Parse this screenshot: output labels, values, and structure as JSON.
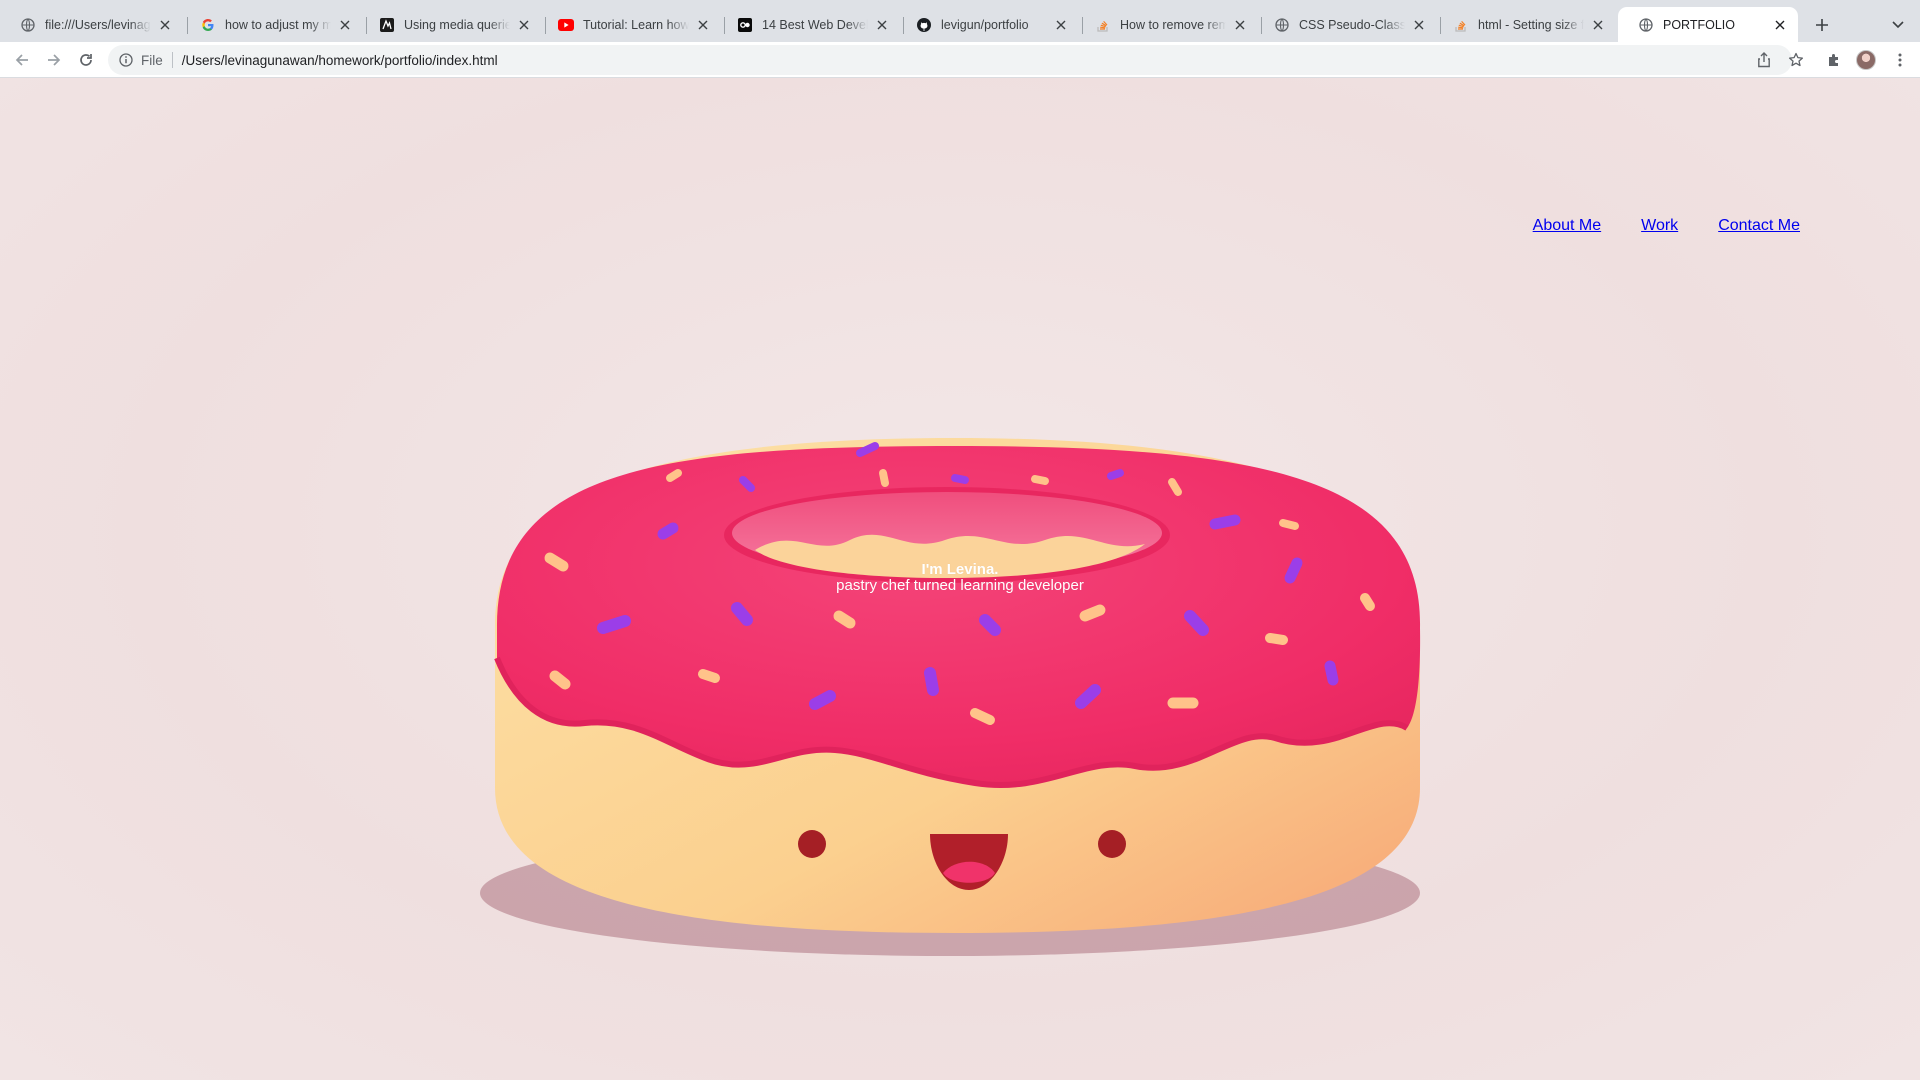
{
  "browser": {
    "tabs": [
      {
        "title": "file:///Users/levinagunawan",
        "icon": "globe-icon",
        "active": false
      },
      {
        "title": "how to adjust my media",
        "icon": "google-icon",
        "active": false
      },
      {
        "title": "Using media queries",
        "icon": "mdn-icon",
        "active": false
      },
      {
        "title": "Tutorial: Learn how to",
        "icon": "youtube-icon",
        "active": false
      },
      {
        "title": "14 Best Web Developer",
        "icon": "dev-icon",
        "active": false
      },
      {
        "title": "levigun/portfolio",
        "icon": "github-icon",
        "active": false
      },
      {
        "title": "How to remove remove",
        "icon": "stackoverflow-icon",
        "active": false
      },
      {
        "title": "CSS Pseudo-Classes",
        "icon": "globe-icon",
        "active": false
      },
      {
        "title": "html - Setting size for",
        "icon": "stackoverflow-icon",
        "active": false
      },
      {
        "title": "PORTFOLIO",
        "icon": "globe-icon",
        "active": true
      }
    ],
    "address": {
      "scheme_label": "File",
      "url": "/Users/levinagunawan/homework/portfolio/index.html"
    }
  },
  "page": {
    "nav": {
      "about": "About Me",
      "work": "Work",
      "contact": "Contact Me"
    },
    "hero": {
      "name": "I'm Levina.",
      "tagline": "pastry chef turned learning developer"
    }
  },
  "colors": {
    "background": "#f2e6e6",
    "frosting": "#f2366c",
    "dough": "#fbd592",
    "shadow": "#c49aa2",
    "sprinkle_purple": "#9b3ee8",
    "sprinkle_yellow": "#ffc38a",
    "link": "#0000ee"
  }
}
